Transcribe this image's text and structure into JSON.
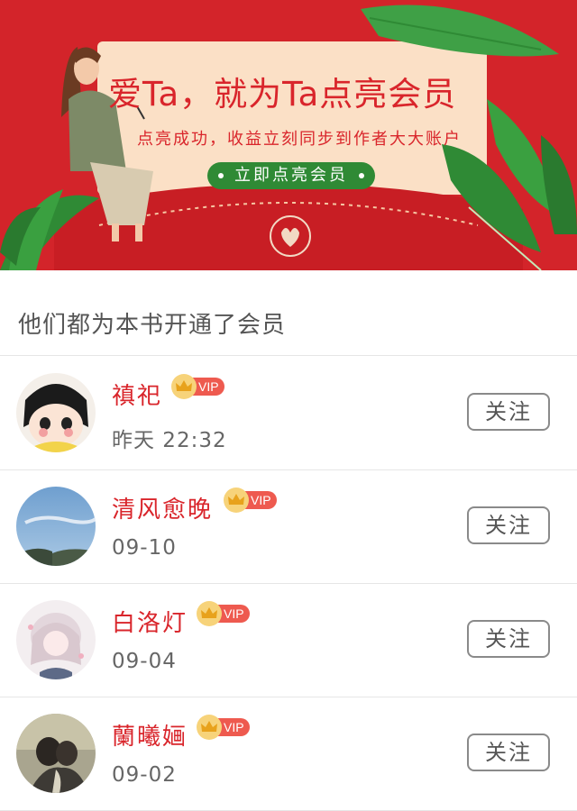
{
  "banner": {
    "title": "爱Ta，就为Ta点亮会员",
    "subtitle": "点亮成功，收益立刻同步到作者大大账户",
    "cta_label": "立即点亮会员"
  },
  "section": {
    "header": "他们都为本书开通了会员"
  },
  "vip_label": "VIP",
  "follow_label": "关注",
  "members": [
    {
      "name": "禛祀",
      "date": "昨天 22:32"
    },
    {
      "name": "清风愈晚",
      "date": "09-10"
    },
    {
      "name": "白洛灯",
      "date": "09-04"
    },
    {
      "name": "蘭曦婳",
      "date": "09-02"
    }
  ],
  "colors": {
    "brand_red": "#d9252b",
    "leaf_green": "#2f8a35",
    "banner_cream": "#fbe0c6"
  }
}
